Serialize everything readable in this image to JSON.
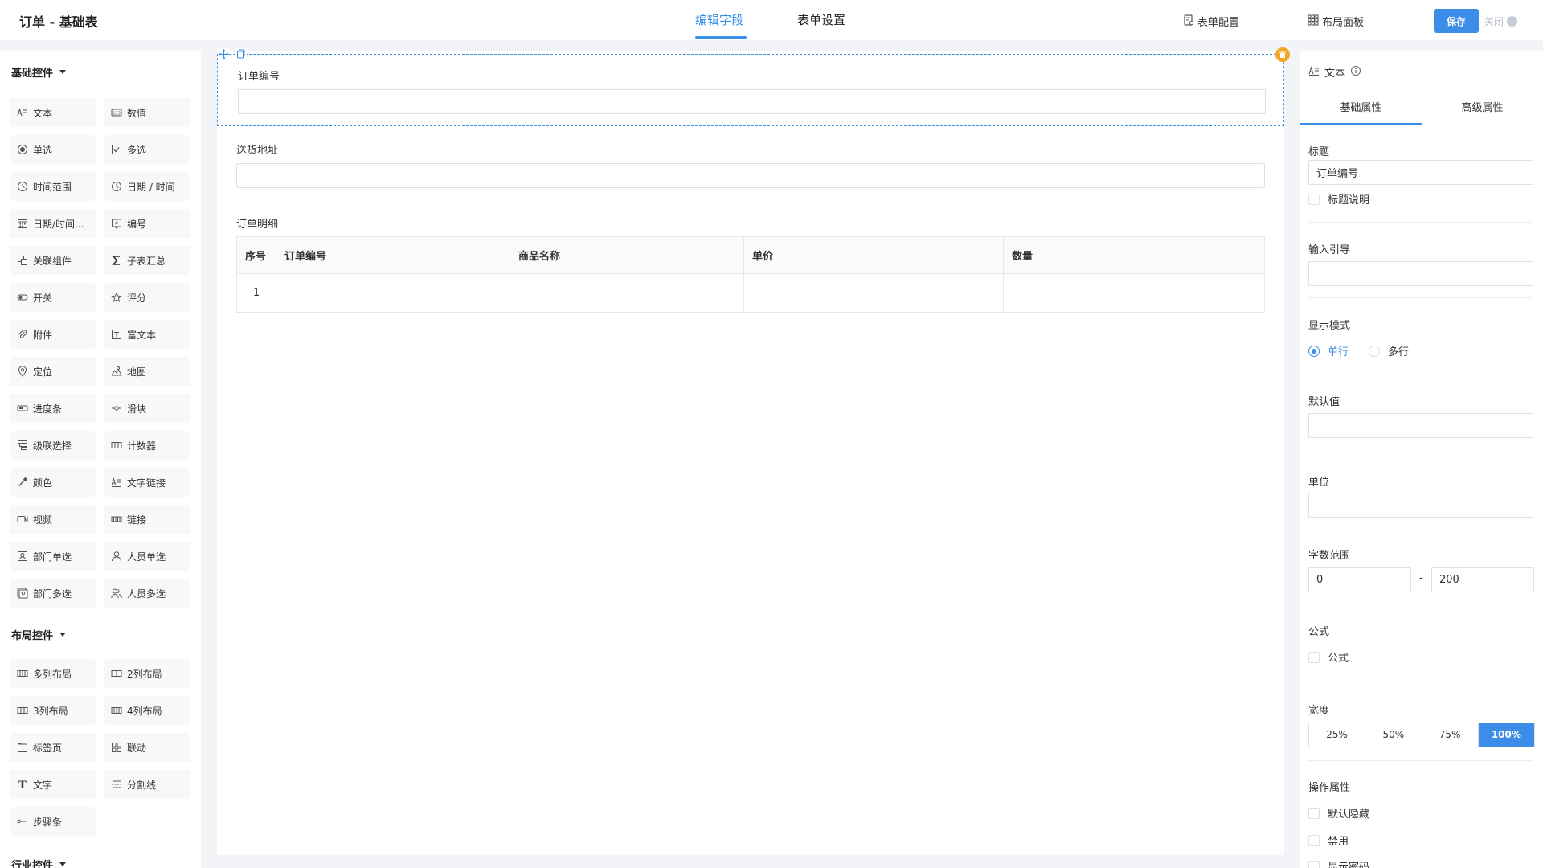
{
  "header": {
    "app_title": "订单 - 基础表",
    "tabs": [
      {
        "label": "编辑字段",
        "active": true
      },
      {
        "label": "表单设置",
        "active": false
      }
    ],
    "form_config_label": "表单配置",
    "layout_panel_label": "布局面板",
    "save_label": "保存",
    "close_label": "关闭",
    "accent_color": "#3b8de8"
  },
  "left": {
    "groups": [
      {
        "title": "基础控件",
        "items": [
          {
            "label": "文本",
            "icon": "text-icon"
          },
          {
            "label": "数值",
            "icon": "number-icon"
          },
          {
            "label": "单选",
            "icon": "radio-icon"
          },
          {
            "label": "多选",
            "icon": "checkbox-icon"
          },
          {
            "label": "时间范围",
            "icon": "clock-icon"
          },
          {
            "label": "日期 / 时间",
            "icon": "clock-icon"
          },
          {
            "label": "日期/时间...",
            "icon": "calendar-icon"
          },
          {
            "label": "编号",
            "icon": "serial-icon"
          },
          {
            "label": "关联组件",
            "icon": "link-component-icon"
          },
          {
            "label": "子表汇总",
            "icon": "sigma-icon"
          },
          {
            "label": "开关",
            "icon": "toggle-icon"
          },
          {
            "label": "评分",
            "icon": "star-icon"
          },
          {
            "label": "附件",
            "icon": "paperclip-icon"
          },
          {
            "label": "富文本",
            "icon": "rich-text-icon"
          },
          {
            "label": "定位",
            "icon": "location-icon"
          },
          {
            "label": "地图",
            "icon": "map-icon"
          },
          {
            "label": "进度条",
            "icon": "progress-icon"
          },
          {
            "label": "滑块",
            "icon": "slider-icon"
          },
          {
            "label": "级联选择",
            "icon": "cascade-icon"
          },
          {
            "label": "计数器",
            "icon": "counter-icon"
          },
          {
            "label": "颜色",
            "icon": "eyedropper-icon"
          },
          {
            "label": "文字链接",
            "icon": "text-link-icon"
          },
          {
            "label": "视频",
            "icon": "video-icon"
          },
          {
            "label": "链接",
            "icon": "link-icon"
          },
          {
            "label": "部门单选",
            "icon": "department-icon"
          },
          {
            "label": "人员单选",
            "icon": "user-icon"
          },
          {
            "label": "部门多选",
            "icon": "departments-icon"
          },
          {
            "label": "人员多选",
            "icon": "users-icon"
          }
        ]
      },
      {
        "title": "布局控件",
        "items": [
          {
            "label": "多列布局",
            "icon": "columns-icon"
          },
          {
            "label": "2列布局",
            "icon": "two-columns-icon"
          },
          {
            "label": "3列布局",
            "icon": "three-columns-icon"
          },
          {
            "label": "4列布局",
            "icon": "four-columns-icon"
          },
          {
            "label": "标签页",
            "icon": "tabs-icon"
          },
          {
            "label": "联动",
            "icon": "grid-icon"
          },
          {
            "label": "文字",
            "icon": "type-icon"
          },
          {
            "label": "分割线",
            "icon": "divider-icon"
          },
          {
            "label": "步骤条",
            "icon": "steps-icon"
          }
        ]
      },
      {
        "title": "行业控件",
        "items": []
      }
    ]
  },
  "canvas": {
    "fields": [
      {
        "label": "订单编号"
      },
      {
        "label": "送货地址"
      }
    ],
    "subtable": {
      "label": "订单明细",
      "columns": [
        "序号",
        "订单编号",
        "商品名称",
        "单价",
        "数量"
      ],
      "rows": [
        [
          "1",
          "",
          "",
          "",
          ""
        ]
      ]
    }
  },
  "right": {
    "header": "文本",
    "tabs": [
      {
        "label": "基础属性",
        "active": true
      },
      {
        "label": "高级属性",
        "active": false
      }
    ],
    "title_label": "标题",
    "title_value": "订单编号",
    "title_desc_label": "标题说明",
    "placeholder_label": "输入引导",
    "placeholder_value": "",
    "display_mode_label": "显示模式",
    "display_modes": [
      {
        "label": "单行",
        "checked": true
      },
      {
        "label": "多行",
        "checked": false
      }
    ],
    "default_label": "默认值",
    "default_value": "",
    "unit_label": "单位",
    "unit_value": "",
    "length_label": "字数范围",
    "length_min": "0",
    "length_sep": "-",
    "length_max": "200",
    "formula_label": "公式",
    "formula_checkbox_label": "公式",
    "width_label": "宽度",
    "width_options": [
      {
        "label": "25%"
      },
      {
        "label": "50%"
      },
      {
        "label": "75%"
      },
      {
        "label": "100%",
        "active": true
      }
    ],
    "ops_label": "操作属性",
    "ops": [
      {
        "label": "默认隐藏"
      },
      {
        "label": "禁用"
      },
      {
        "label": "显示密码"
      }
    ]
  }
}
